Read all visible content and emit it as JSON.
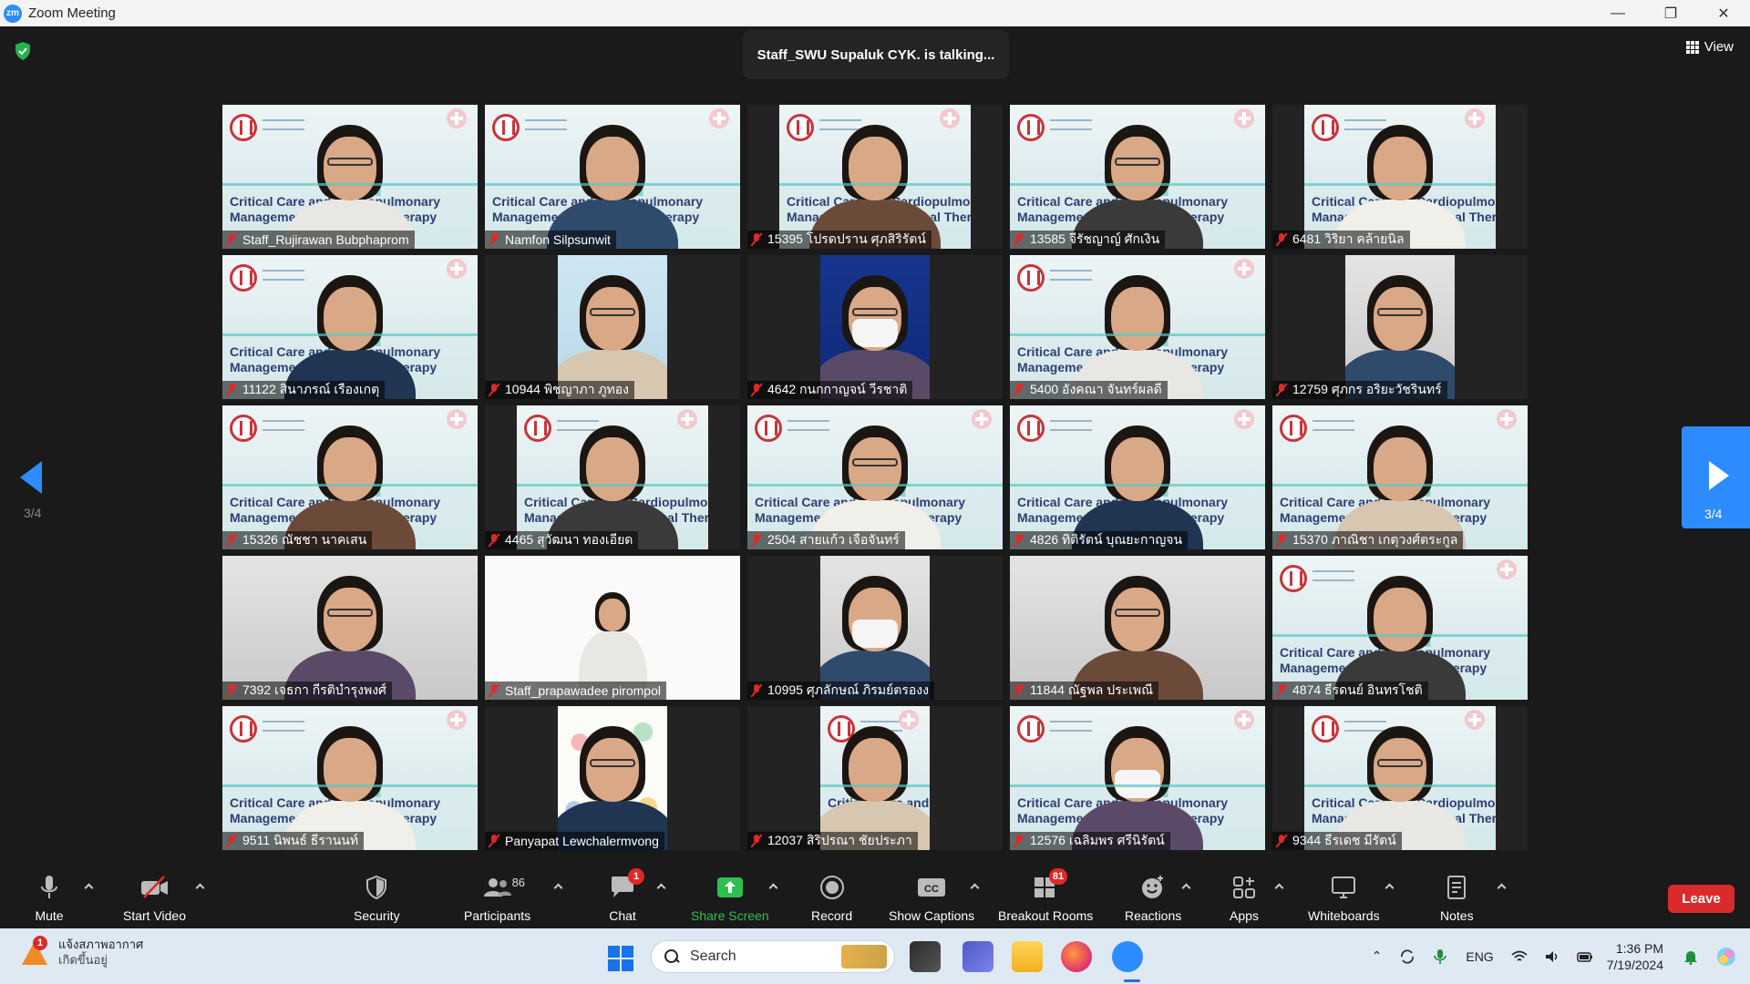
{
  "window": {
    "title": "Zoom Meeting",
    "logo_text": "zm"
  },
  "meeting": {
    "talking_banner": "Staff_SWU Supaluk CYK. is talking...",
    "view_label": "View",
    "page_indicator": "3/4",
    "next_page_indicator": "3/4"
  },
  "banner_text": {
    "line1": "Critical Care and Cardiopulmonary",
    "line2": "Management for Physical Therapy"
  },
  "participants": [
    {
      "name": "Staff_Rujirawan Bubphaprom",
      "bg": "critical",
      "frame": "full",
      "muted": true
    },
    {
      "name": "Namfon Silpsunwit",
      "bg": "critical",
      "frame": "full",
      "muted": true
    },
    {
      "name": "15395 โปรดปราน ศุภสิริรัตน์",
      "bg": "critical",
      "frame": "narrow",
      "muted": true
    },
    {
      "name": "13585 จีรัชญาญ์ ศักเงิน",
      "bg": "critical",
      "frame": "full",
      "muted": true
    },
    {
      "name": "6481 วิริยา คล้ายนิล",
      "bg": "critical",
      "frame": "narrow",
      "muted": true
    },
    {
      "name": "11122 สินาภรณ์ เรืองเกตุ",
      "bg": "critical",
      "frame": "full",
      "muted": true
    },
    {
      "name": "10944 พิชญาภา ภูทอง",
      "bg": "sky",
      "frame": "xnarrow",
      "muted": true
    },
    {
      "name": "4642 กนกกาญจน์ วีรชาติ",
      "bg": "blue",
      "frame": "xnarrow",
      "muted": true
    },
    {
      "name": "5400 อังคณา จันทร์ผลดี",
      "bg": "critical",
      "frame": "full",
      "muted": true
    },
    {
      "name": "12759 ศุภกร อริยะวัชรินทร์",
      "bg": "room",
      "frame": "xnarrow",
      "muted": true
    },
    {
      "name": "15326 ณัชชา นาคเสน",
      "bg": "critical",
      "frame": "full",
      "muted": true
    },
    {
      "name": "4465 สุวัฒนา ทองเอียด",
      "bg": "critical",
      "frame": "narrow",
      "muted": true
    },
    {
      "name": "2504 สายแก้ว เจือจันทร์",
      "bg": "critical",
      "frame": "full",
      "muted": true
    },
    {
      "name": "4826 ทิติรัตน์ บุณยะกาญจน",
      "bg": "critical",
      "frame": "full",
      "muted": true
    },
    {
      "name": "15370 ภาณิชา เกตุวงศ์ตระกูล",
      "bg": "critical",
      "frame": "full",
      "muted": true
    },
    {
      "name": "7392 เจธกา กีรติบำรุงพงศ์",
      "bg": "room",
      "frame": "full",
      "muted": true
    },
    {
      "name": "Staff_prapawadee pirompol",
      "bg": "white",
      "frame": "full",
      "muted": true
    },
    {
      "name": "10995 ศุภลักษณ์ ภิรมย์ตรองง",
      "bg": "room",
      "frame": "xnarrow",
      "muted": true
    },
    {
      "name": "11844 ณัฐพล ประเพณี",
      "bg": "room",
      "frame": "full",
      "muted": true
    },
    {
      "name": "4874 ธีรดนย์ อินทรโชติ",
      "bg": "critical",
      "frame": "full",
      "muted": true
    },
    {
      "name": "9511 นิพนธ์ ธีรานนท์",
      "bg": "critical",
      "frame": "full",
      "muted": true
    },
    {
      "name": "Panyapat Lewchalermvong",
      "bg": "dots",
      "frame": "xnarrow",
      "muted": true
    },
    {
      "name": "12037 สิริปรณา ชัยประภา",
      "bg": "critical",
      "frame": "xnarrow",
      "muted": true
    },
    {
      "name": "12576 เฉลิมพร ศรีนิรัตน์",
      "bg": "critical",
      "frame": "full",
      "muted": true
    },
    {
      "name": "9344 ธีรเดช มีรัตน์",
      "bg": "critical",
      "frame": "narrow",
      "muted": true
    }
  ],
  "toolbar": {
    "mute": "Mute",
    "start_video": "Start Video",
    "security": "Security",
    "participants": "Participants",
    "participants_count": "86",
    "chat": "Chat",
    "chat_badge": "1",
    "share_screen": "Share Screen",
    "record": "Record",
    "show_captions": "Show Captions",
    "captions_icon_text": "CC",
    "breakout_rooms": "Breakout Rooms",
    "breakout_badge": "81",
    "reactions": "Reactions",
    "apps": "Apps",
    "whiteboards": "Whiteboards",
    "notes": "Notes",
    "leave": "Leave"
  },
  "colors": {
    "zoom_blue": "#2d8cff",
    "share_green": "#2fbf50",
    "leave_red": "#d92b2b",
    "mute_red": "#e02828"
  },
  "taskbar": {
    "weather_badge": "1",
    "weather_title": "แจ้งสภาพอากาศ",
    "weather_sub": "เกิดขึ้นอยู่",
    "search_placeholder": "Search",
    "language": "ENG",
    "time": "1:36 PM",
    "date": "7/19/2024"
  }
}
